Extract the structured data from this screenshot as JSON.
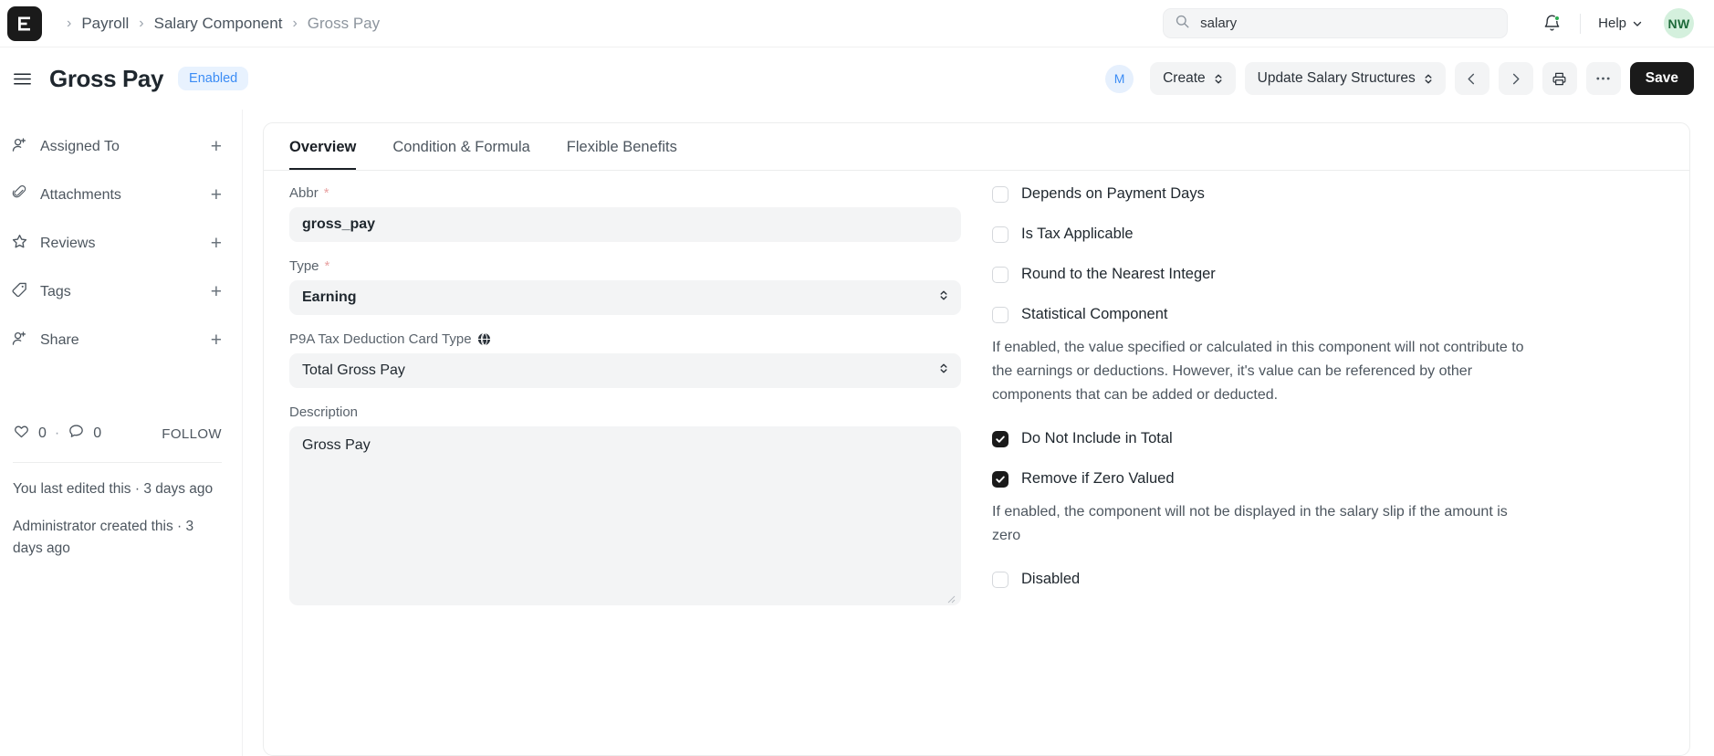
{
  "navbar": {
    "logo_name": "frappe-logo",
    "breadcrumb": [
      {
        "label": "Payroll",
        "current": false
      },
      {
        "label": "Salary Component",
        "current": false
      },
      {
        "label": "Gross Pay",
        "current": true
      }
    ],
    "separator": "›",
    "search": {
      "value": "salary",
      "placeholder": "Search"
    },
    "help_label": "Help",
    "avatar_initials": "NW",
    "notification_dot_color": "#2bac52"
  },
  "pagehead": {
    "title": "Gross Pay",
    "status_badge": "Enabled",
    "status_badge_color": "#3b8cf5",
    "assignee_initial": "M",
    "create_label": "Create",
    "update_label": "Update Salary Structures",
    "prev_label": "‹",
    "next_label": "›",
    "save_label": "Save"
  },
  "sidebar": {
    "items": [
      {
        "label": "Assigned To",
        "icon": "user-plus-icon",
        "action": "+"
      },
      {
        "label": "Attachments",
        "icon": "paperclip-icon",
        "action": "+"
      },
      {
        "label": "Reviews",
        "icon": "star-icon",
        "action": "+"
      },
      {
        "label": "Tags",
        "icon": "tag-icon",
        "action": "+"
      },
      {
        "label": "Share",
        "icon": "user-plus-icon",
        "action": "+"
      }
    ],
    "like_count": "0",
    "comment_count": "0",
    "separator_dot": "·",
    "follow_label": "FOLLOW",
    "edited_note": "You last edited this · 3 days ago",
    "created_note": "Administrator created this · 3 days ago"
  },
  "tabs": [
    {
      "label": "Overview",
      "active": true
    },
    {
      "label": "Condition & Formula",
      "active": false
    },
    {
      "label": "Flexible Benefits",
      "active": false
    }
  ],
  "form": {
    "abbr": {
      "label": "Abbr",
      "required": "*",
      "value": "gross_pay"
    },
    "type": {
      "label": "Type",
      "required": "*",
      "value": "Earning"
    },
    "p9a": {
      "label": "P9A Tax Deduction Card Type",
      "icon": "globe-icon",
      "value": "Total Gross Pay"
    },
    "description": {
      "label": "Description",
      "value": "Gross Pay"
    }
  },
  "options": {
    "checkboxes": [
      {
        "label": "Depends on Payment Days",
        "checked": false
      },
      {
        "label": "Is Tax Applicable",
        "checked": false
      },
      {
        "label": "Round to the Nearest Integer",
        "checked": false
      },
      {
        "label": "Statistical Component",
        "checked": false
      }
    ],
    "statistical_help": "If enabled, the value specified or calculated in this component will not contribute to the earnings or deductions. However, it's value can be referenced by other components that can be added or deducted.",
    "do_not_include": {
      "label": "Do Not Include in Total",
      "checked": true
    },
    "remove_if_zero": {
      "label": "Remove if Zero Valued",
      "checked": true
    },
    "remove_if_zero_help": "If enabled, the component will not be displayed in the salary slip if the amount is zero",
    "disabled": {
      "label": "Disabled",
      "checked": false
    }
  }
}
